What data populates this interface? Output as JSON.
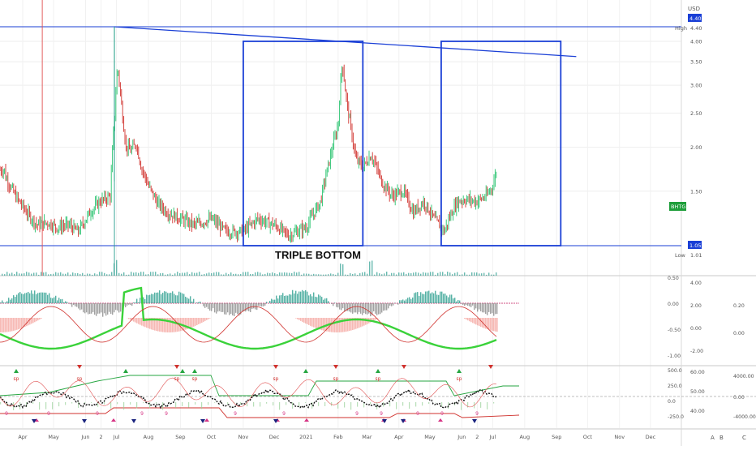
{
  "chart_data": {
    "type": "line",
    "title": "",
    "currency": "USD",
    "symbol_badge": "BHTG",
    "annotation": "TRIPLE BOTTOM",
    "price_axis": {
      "ticks": [
        "4.40",
        "4.00",
        "3.50",
        "3.00",
        "2.50",
        "2.00",
        "1.50",
        "1.05"
      ],
      "values": [
        4.4,
        4.0,
        3.5,
        3.0,
        2.5,
        2.0,
        1.5,
        1.05
      ],
      "ylim": [
        0.97,
        4.55
      ],
      "scale": "log"
    },
    "price_labels": {
      "high": {
        "label": "High",
        "value": "4.40"
      },
      "low": {
        "label": "Low",
        "value": "1.01"
      },
      "current_badge": "4.40"
    },
    "x_ticks": [
      "Apr",
      "May",
      "Jun",
      "2",
      "Jul",
      "Aug",
      "Sep",
      "Oct",
      "Nov",
      "Dec",
      "2021",
      "Feb",
      "Mar",
      "Apr",
      "May",
      "Jun",
      "2",
      "Jul",
      "Aug",
      "Sep",
      "Oct",
      "Nov",
      "Dec"
    ],
    "series": [
      {
        "name": "",
        "x": [
          "2020-03-15",
          "2020-03-25",
          "2020-04-05",
          "2020-04-15",
          "2020-04-25",
          "2020-05-05",
          "2020-05-15",
          "2020-05-25",
          "2020-06-05",
          "2020-06-15",
          "2020-06-25",
          "2020-06-29",
          "2020-07-02",
          "2020-07-06",
          "2020-07-10",
          "2020-07-15",
          "2020-07-20",
          "2020-07-25",
          "2020-08-01",
          "2020-08-10",
          "2020-08-20",
          "2020-09-01",
          "2020-09-15",
          "2020-10-01",
          "2020-10-15",
          "2020-11-01",
          "2020-11-15",
          "2020-12-01",
          "2020-12-15",
          "2021-01-01",
          "2021-01-15",
          "2021-01-25",
          "2021-02-01",
          "2021-02-05",
          "2021-02-08",
          "2021-02-10",
          "2021-02-14",
          "2021-02-18",
          "2021-02-25",
          "2021-03-05",
          "2021-03-15",
          "2021-03-25",
          "2021-04-05",
          "2021-04-15",
          "2021-04-25",
          "2021-05-05",
          "2021-05-15",
          "2021-05-22",
          "2021-05-28",
          "2021-06-05",
          "2021-06-15",
          "2021-06-25",
          "2021-07-01",
          "2021-07-05"
        ],
        "values": [
          1.65,
          1.45,
          1.3,
          1.2,
          1.22,
          1.18,
          1.2,
          1.15,
          1.3,
          1.4,
          1.45,
          2.4,
          3.4,
          2.6,
          2.0,
          1.95,
          2.05,
          1.75,
          1.55,
          1.38,
          1.3,
          1.25,
          1.2,
          1.25,
          1.15,
          1.15,
          1.25,
          1.2,
          1.12,
          1.18,
          1.4,
          1.9,
          2.3,
          3.5,
          2.9,
          2.6,
          2.2,
          1.85,
          1.75,
          1.9,
          1.6,
          1.45,
          1.5,
          1.3,
          1.4,
          1.25,
          1.15,
          1.3,
          1.4,
          1.42,
          1.4,
          1.45,
          1.55,
          1.72
        ]
      }
    ],
    "spike_high": {
      "x": "2020-06-29",
      "value": 4.4
    },
    "trendline": {
      "x": [
        "2020-06-29",
        "2021-09-20"
      ],
      "values": [
        4.4,
        3.62
      ]
    },
    "horizontal_lines": [
      4.4,
      1.05
    ],
    "boxes": [
      {
        "x": [
          "2020-11-01",
          "2021-02-25"
        ],
        "y": [
          1.05,
          4.0
        ]
      },
      {
        "x": [
          "2021-05-12",
          "2021-09-05"
        ],
        "y": [
          1.05,
          4.0
        ]
      }
    ],
    "vertical_marker_red": "2020-04-20",
    "vertical_marker_cyan": "2020-06-29",
    "panel1_axis_left": [
      "0.50",
      "0.00",
      "-0.50",
      "-1.00"
    ],
    "panel1_axis_mid": [
      "4.00",
      "2.00",
      "0.00",
      "-2.00"
    ],
    "panel1_axis_right": [
      "0.20",
      "0.00"
    ],
    "panel2_axis_left": [
      "500.0",
      "250.0",
      "0.0",
      "-250.0"
    ],
    "panel2_axis_mid": [
      "60.00",
      "50.00",
      "40.00"
    ],
    "panel2_axis_right": [
      "4000.00",
      "0.00",
      "-4000.00"
    ],
    "panel2_labels": {
      "sp": "sp",
      "nine": "9"
    },
    "grid": true,
    "corner_letters": [
      "A",
      "B",
      "C"
    ],
    "colors": {
      "up": "#26c26d",
      "down": "#d0312d",
      "lines": "#1a3fd6",
      "background": "#ffffff",
      "badge_green": "#1e9e3a",
      "badge_blue": "#1a3fd6"
    }
  }
}
